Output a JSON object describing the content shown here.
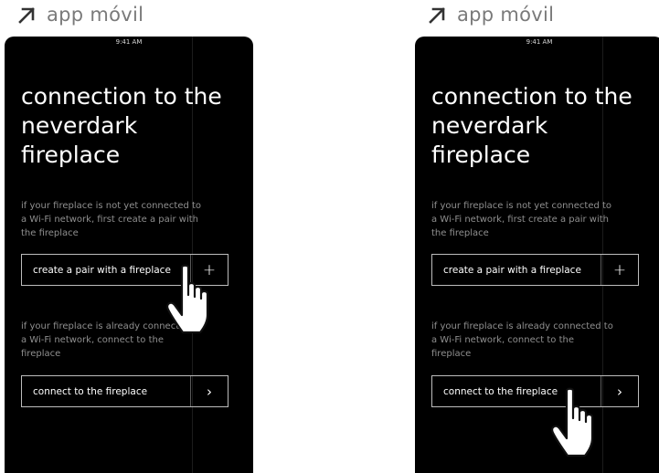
{
  "panels": [
    {
      "label": "app móvil",
      "status_time": "9:41 AM",
      "title": "connection to the neverdark fireplace",
      "description_pair": "if your fireplace is not yet connected to a Wi-Fi network, first create a pair with the fireplace",
      "button_pair_label": "create a pair with a fireplace",
      "button_pair_icon": "plus-icon",
      "description_connect": "if your fireplace is already connected to a Wi-Fi network, connect to the fireplace",
      "button_connect_label": "connect to the fireplace",
      "button_connect_icon": "chevron-right-icon",
      "cursor_target": "create-pair-button"
    },
    {
      "label": "app móvil",
      "status_time": "9:41 AM",
      "title": "connection to the neverdark fireplace",
      "description_pair": "if your fireplace is not yet connected to a Wi-Fi network, first create a pair with the fireplace",
      "button_pair_label": "create a pair with a fireplace",
      "button_pair_icon": "plus-icon",
      "description_connect": "if your fireplace is already connected to a Wi-Fi network, connect to the fireplace",
      "button_connect_label": "connect to the fireplace",
      "button_connect_icon": "chevron-right-icon",
      "cursor_target": "connect-button"
    }
  ],
  "colors": {
    "phone_background": "#000000",
    "label_gray": "#7a7a7a",
    "text_white": "#ffffff",
    "description_gray": "#8f8f8f",
    "button_border": "#bdbdbd"
  }
}
